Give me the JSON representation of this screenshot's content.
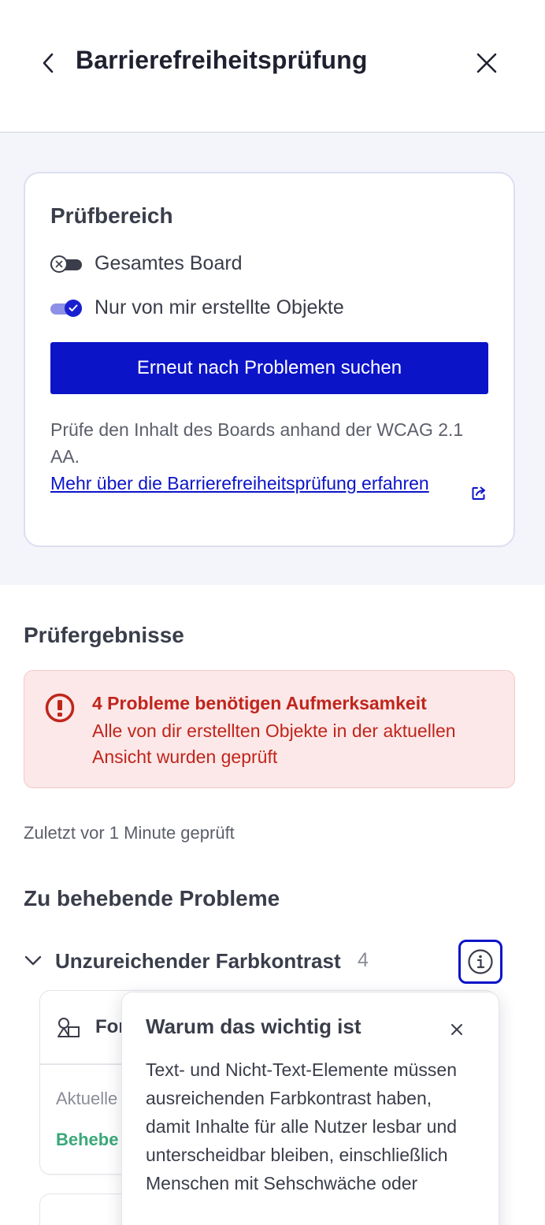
{
  "header": {
    "title": "Barrierefreiheitsprüfung",
    "back_icon": "chevron-left-icon",
    "close_icon": "close-icon"
  },
  "scope": {
    "title": "Prüfbereich",
    "options": [
      {
        "label": "Gesamtes Board",
        "checked": false
      },
      {
        "label": "Nur von mir erstellte Objekte",
        "checked": true
      }
    ],
    "button_label": "Erneut nach Problemen suchen",
    "description": "Prüfe den Inhalt des Boards anhand der WCAG 2.1 AA.",
    "link_text": "Mehr über die Barrierefreiheitsprüfung erfahren"
  },
  "results": {
    "title": "Prüfergebnisse",
    "alert_title": "4 Probleme benötigen Aufmerksamkeit",
    "alert_text": "Alle von dir erstellten Objekte in der aktuellen Ansicht wurden geprüft",
    "last_checked": "Zuletzt vor 1 Minute geprüft"
  },
  "issues": {
    "title": "Zu behebende Probleme",
    "group_label": "Unzureichender Farbkontrast",
    "group_count": "4",
    "card": {
      "title": "For",
      "current_label": "Aktuelle",
      "fix_label": "Behebe"
    }
  },
  "popover": {
    "title": "Warum das wichtig ist",
    "text": "Text- und Nicht-Text-Elemente müssen ausreichenden Farbkontrast haben, damit Inhalte für alle Nutzer lesbar und unterscheidbar bleiben, einschließlich Menschen mit Sehschwäche oder"
  },
  "colors": {
    "primary": "#0c14c8",
    "error": "#c0251c",
    "error_bg": "#fce8e8",
    "success": "#3aa87a"
  }
}
